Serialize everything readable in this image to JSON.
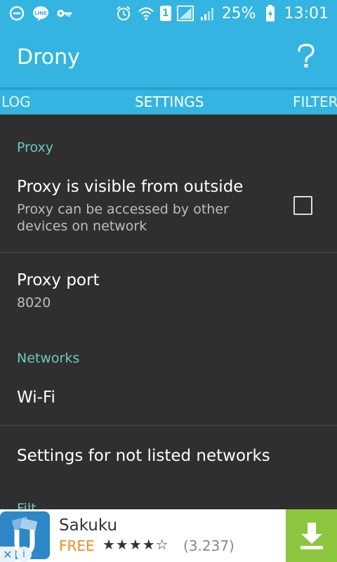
{
  "status_bar": {
    "battery_percent": "25%",
    "time": "13:01",
    "sim_slot": "1",
    "icons": [
      "minus-circle-icon",
      "line-app-icon",
      "key-icon",
      "alarm-icon",
      "wifi-icon",
      "signal-icon",
      "battery-charging-icon"
    ]
  },
  "app_bar": {
    "title": "Drony",
    "help_icon": "question-mark-icon"
  },
  "tabs": [
    {
      "label": "LOG"
    },
    {
      "label": "SETTINGS"
    },
    {
      "label": "FILTER"
    }
  ],
  "sections": {
    "proxy": {
      "header": "Proxy",
      "visible_outside": {
        "title": "Proxy is visible from outside",
        "summary_line1": "Proxy can be accessed by other",
        "summary_line2": "devices on network",
        "checked": false
      },
      "port": {
        "title": "Proxy port",
        "value": "8020"
      }
    },
    "networks": {
      "header": "Networks",
      "wifi": {
        "title": "Wi-Fi"
      },
      "not_listed": {
        "title": "Settings for not listed networks"
      }
    },
    "filter": {
      "header_partial": "Filt"
    }
  },
  "ad": {
    "app_name": "Sakuku",
    "price": "FREE",
    "stars": "★★★★☆",
    "rating_count": "(3.237)",
    "download_icon": "download-arrow-icon",
    "close_symbol": "✕",
    "info_symbol": "i"
  },
  "colors": {
    "primary": "#34b4e0",
    "background": "#2f2f2f",
    "section_header": "#6fc9c0",
    "ad_download": "#8cc63e",
    "ad_price": "#f58b1f"
  }
}
